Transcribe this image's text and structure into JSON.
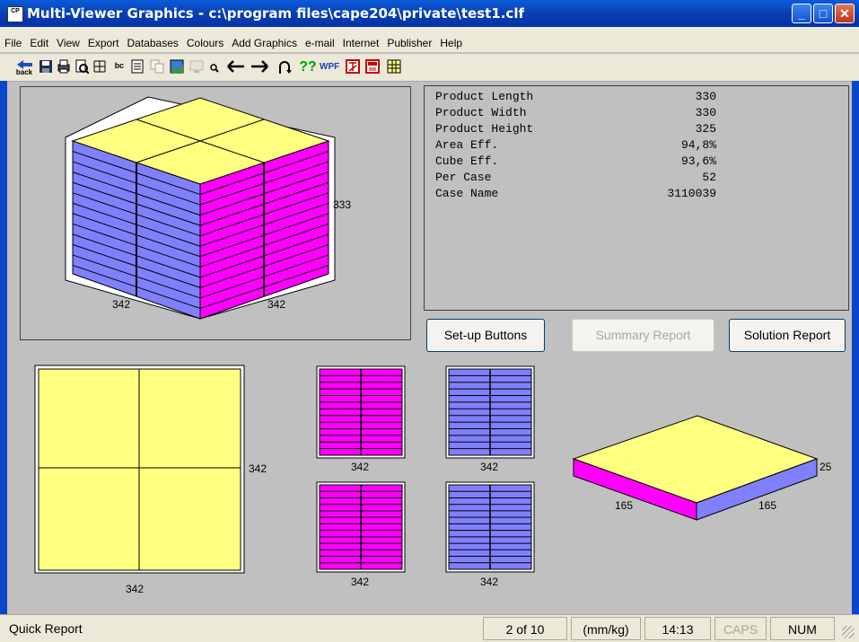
{
  "window": {
    "title": "Multi-Viewer Graphics - c:\\program files\\cape204\\private\\test1.clf",
    "app_icon": "CP"
  },
  "menu": [
    "File",
    "Edit",
    "View",
    "Export",
    "Databases",
    "Colours",
    "Add Graphics",
    "e-mail",
    "Internet",
    "Publisher",
    "Help"
  ],
  "toolbar_icons": [
    "back-icon",
    "save-icon",
    "print-icon",
    "print-preview-icon",
    "grid-icon",
    "text-icon",
    "notepad-icon",
    "copy-icon",
    "image-icon",
    "monitor-icon",
    "zoom-icon",
    "left-arrow-icon",
    "right-arrow-icon",
    "rotate-icon",
    "help-icon",
    "wpf-icon",
    "pdf-icon",
    "pdf2-icon",
    "table-icon"
  ],
  "toolbar": {
    "back_label": "back",
    "help_label": "??",
    "wpf_label": "WPF"
  },
  "info": {
    "rows": [
      {
        "label": "Product Length",
        "value": "330"
      },
      {
        "label": "Product Width",
        "value": "330"
      },
      {
        "label": "Product Height",
        "value": "325"
      },
      {
        "label": "Area Eff.",
        "value": "94,8%"
      },
      {
        "label": "Cube Eff.",
        "value": "93,6%"
      },
      {
        "label": "Per Case",
        "value": "52"
      },
      {
        "label": "Case Name",
        "value": "3110039"
      }
    ]
  },
  "buttons": {
    "setup": "Set-up Buttons",
    "summary": "Summary Report",
    "solution": "Solution Report"
  },
  "dims": {
    "pallet_height": "333",
    "pallet_left": "342",
    "pallet_right": "342",
    "top_right": "342",
    "top_bottom": "342",
    "side1": "342",
    "side2": "342",
    "side3": "342",
    "side4": "342",
    "case_height": "25",
    "case_left": "165",
    "case_right": "165"
  },
  "status": {
    "left": "Quick Report",
    "page": "2 of 10",
    "units": "(mm/kg)",
    "time": "14:13",
    "caps": "CAPS",
    "num": "NUM"
  },
  "colors": {
    "yellow": "#ffff80",
    "blue": "#8080ff",
    "magenta": "#ff00ff",
    "titlebar": "#0a5bd9"
  }
}
